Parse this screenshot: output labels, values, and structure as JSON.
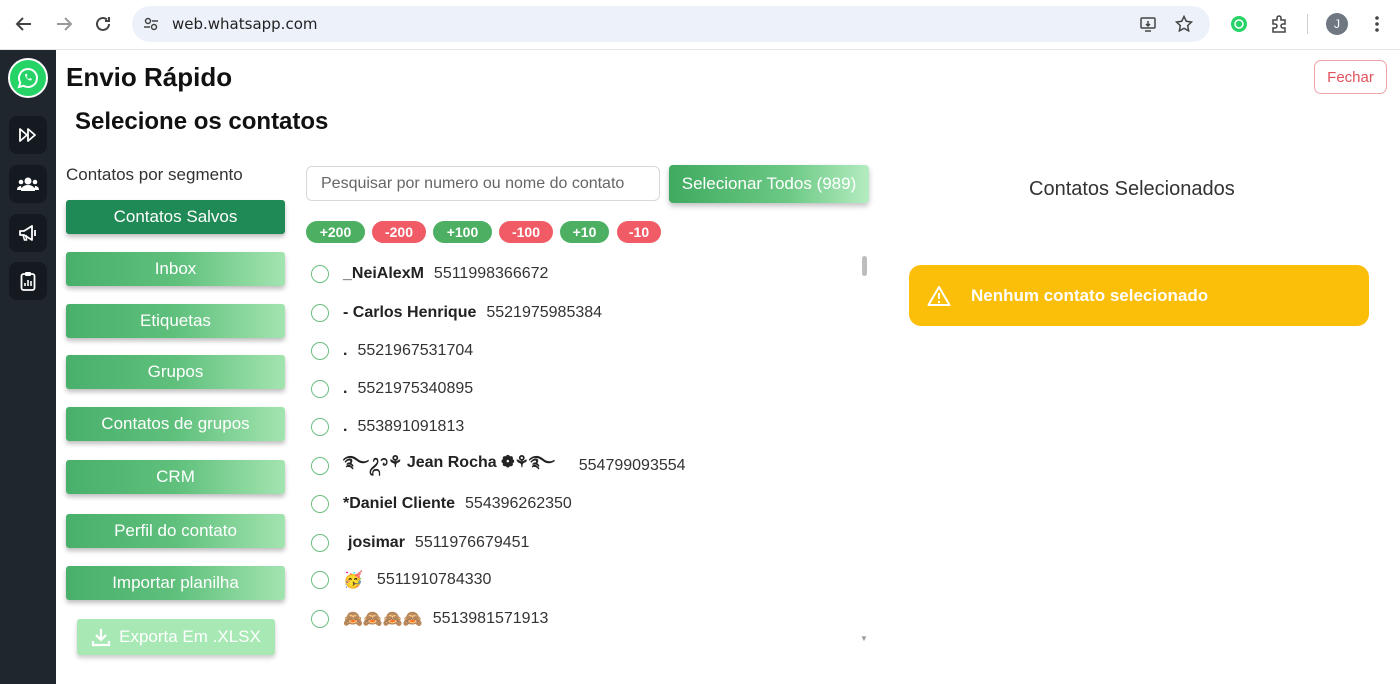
{
  "browser": {
    "url": "web.whatsapp.com",
    "avatar_letter": "J"
  },
  "rail": {
    "items": [
      "whatsapp-logo",
      "fast-forward-icon",
      "users-icon",
      "megaphone-icon",
      "clipboard-icon"
    ]
  },
  "app": {
    "title": "Envio Rápido",
    "close_label": "Fechar",
    "section_title": "Selecione os contatos"
  },
  "segments": {
    "heading": "Contatos por segmento",
    "items": [
      {
        "label": "Contatos Salvos",
        "active": true
      },
      {
        "label": "Inbox",
        "active": false
      },
      {
        "label": "Etiquetas",
        "active": false
      },
      {
        "label": "Grupos",
        "active": false
      },
      {
        "label": "Contatos de grupos",
        "active": false
      },
      {
        "label": "CRM",
        "active": false
      },
      {
        "label": "Perfil do contato",
        "active": false
      },
      {
        "label": "Importar planilha",
        "active": false
      }
    ],
    "export_label": "Exporta Em .XLSX"
  },
  "search": {
    "placeholder": "Pesquisar por numero ou nome do contato",
    "select_all_label": "Selecionar Todos (989)"
  },
  "pills": [
    "+200",
    "-200",
    "+100",
    "-100",
    "+10",
    "-10"
  ],
  "contacts": [
    {
      "name": "_NeiAlexM",
      "number": "5511998366672"
    },
    {
      "name": "- Carlos Henrique",
      "number": "5521975985384"
    },
    {
      "name": ".",
      "number": "5521967531704"
    },
    {
      "name": ".",
      "number": "5521975340895"
    },
    {
      "name": ".",
      "number": "553891091813"
    },
    {
      "name": "࿐ᬊ⚘ Jean Rocha ❁⚘࿐",
      "number": "554799093554"
    },
    {
      "name": "*Daniel Cliente",
      "number": "554396262350"
    },
    {
      "name": " josimar",
      "number": "5511976679451"
    },
    {
      "name": "🥳",
      "number": "5511910784330"
    },
    {
      "name": "🙈🙈🙈🙈",
      "number": "5513981571913"
    }
  ],
  "selected": {
    "heading": "Contatos Selecionados",
    "empty_message": "Nenhum contato selecionado"
  },
  "colors": {
    "rail_bg": "#1f262e",
    "primary_green": "#1f8a55",
    "warning": "#fbbf0a",
    "danger": "#f05b66"
  }
}
